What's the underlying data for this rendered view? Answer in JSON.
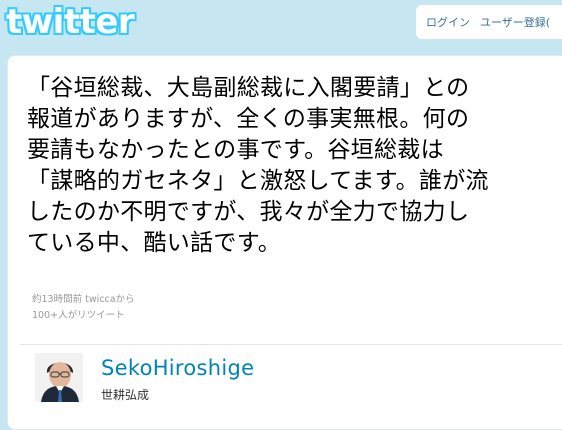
{
  "header": {
    "logo": "twitter",
    "login_label": "ログイン",
    "signup_label": "ユーザー登録("
  },
  "tweet": {
    "text": "「谷垣総裁、大島副総裁に入閣要請」との\n報道がありますが、全くの事実無根。何の\n要請もなかったとの事です。谷垣総裁は\n「謀略的ガセネタ」と激怒してます。誰が流\nしたのか不明ですが、我々が全力で協力し\nている中、酷い話です。",
    "time_text": "約13時間前 twiccaから",
    "retweet_text": "100+人がリツイート"
  },
  "user": {
    "screen_name": "SekoHiroshige",
    "full_name": "世耕弘成"
  },
  "colors": {
    "background": "#c6e6f1",
    "logo_fill": "#ffffff",
    "logo_outline": "#33ccff",
    "link": "#0084b4",
    "meta": "#999999"
  }
}
